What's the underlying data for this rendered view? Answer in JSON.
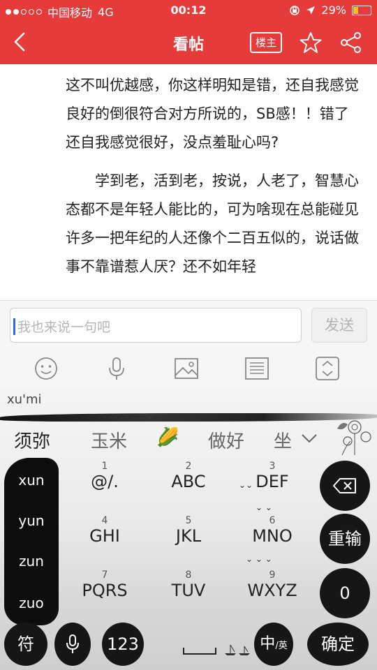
{
  "status_bar": {
    "carrier": "中国移动",
    "network": "4G",
    "time": "00:12",
    "battery": "29%"
  },
  "nav": {
    "title": "看帖",
    "louzhu_label": "楼主"
  },
  "post": {
    "paragraphs": [
      " 这不叫优越感，你这样明知是错，还自我感觉良好的倒很符合对方所说的，SB感！！错了还自我感觉很好，没点羞耻心吗?",
      "学到老，活到老，按说，人老了，智慧心态都不是年轻人能比的，可为啥现在总能碰见许多一把年纪的人还像个二百五似的，说话做事不靠谱惹人厌？还不如年轻"
    ]
  },
  "comment": {
    "placeholder": "我也来说一句吧",
    "send_label": "发送"
  },
  "toolbar": {
    "icons": [
      "emoji-icon",
      "microphone-icon",
      "image-icon",
      "list-icon",
      "expand-icon"
    ]
  },
  "keyboard": {
    "pinyin": "xu'mi",
    "candidates": [
      "须弥",
      "玉米",
      "🌽",
      "做好",
      "坐"
    ],
    "left_column": [
      "xun",
      "yun",
      "zun",
      "zuo"
    ],
    "keys": [
      {
        "num": "1",
        "label": "@/."
      },
      {
        "num": "2",
        "label": "ABC"
      },
      {
        "num": "3",
        "label": "DEF"
      },
      {
        "num": "4",
        "label": "GHI"
      },
      {
        "num": "5",
        "label": "JKL"
      },
      {
        "num": "6",
        "label": "MNO"
      },
      {
        "num": "7",
        "label": "PQRS"
      },
      {
        "num": "8",
        "label": "TUV"
      },
      {
        "num": "9",
        "label": "WXYZ"
      }
    ],
    "right_keys": {
      "reinput": "重输",
      "zero": "0"
    },
    "bottom": {
      "symbol": "符",
      "numbers": "123",
      "lang": "中",
      "lang_sub": "/英",
      "confirm": "确定"
    }
  },
  "colors": {
    "header": "#e63b3b",
    "keyboard_ink": "#161616"
  }
}
